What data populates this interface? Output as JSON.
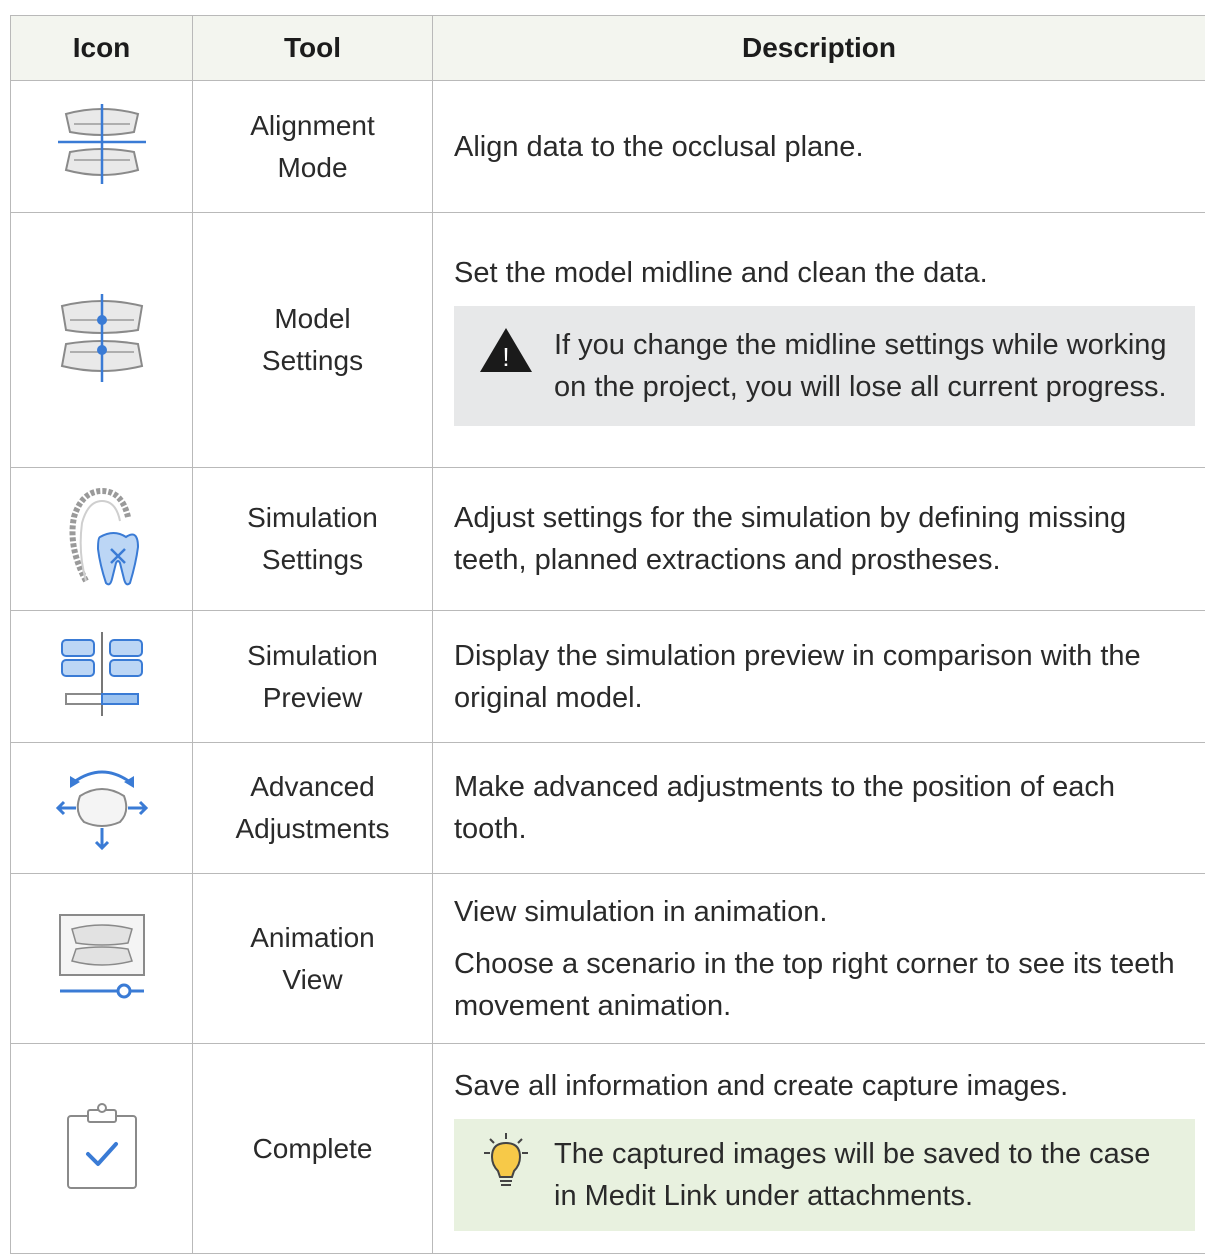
{
  "header": {
    "icon": "Icon",
    "tool": "Tool",
    "description": "Description"
  },
  "rows": [
    {
      "icon": "alignment-mode-icon",
      "tool": "Alignment Mode",
      "desc": [
        "Align data to the occlusal plane."
      ]
    },
    {
      "icon": "model-settings-icon",
      "tool": "Model Settings",
      "desc": [
        "Set the model midline and clean the data."
      ],
      "note": {
        "type": "warning",
        "icon": "warning-icon",
        "text": "If you change the midline settings while working on the project, you will lose all current progress."
      }
    },
    {
      "icon": "simulation-settings-icon",
      "tool": "Simulation Settings",
      "desc": [
        "Adjust settings for the simulation by defining missing teeth, planned extractions and prostheses."
      ]
    },
    {
      "icon": "simulation-preview-icon",
      "tool": "Simulation Preview",
      "desc": [
        "Display the simulation preview in comparison with the original model."
      ]
    },
    {
      "icon": "advanced-adjustments-icon",
      "tool": "Advanced Adjustments",
      "desc": [
        "Make advanced adjustments to the position of each tooth."
      ]
    },
    {
      "icon": "animation-view-icon",
      "tool": "Animation View",
      "desc": [
        "View simulation in animation.",
        "Choose a scenario in the top right corner to see its teeth movement animation."
      ]
    },
    {
      "icon": "complete-icon",
      "tool": "Complete",
      "desc": [
        "Save all information and create capture images."
      ],
      "note": {
        "type": "tip",
        "icon": "lightbulb-icon",
        "text": "The captured images will be saved to the case in Medit Link under attachments."
      }
    }
  ],
  "colors": {
    "accent": "#3a7bd5",
    "header_bg": "#f3f5ef",
    "warning_bg": "#e7e8e9",
    "tip_bg": "#e8f1df",
    "border": "#b9b9b9"
  }
}
